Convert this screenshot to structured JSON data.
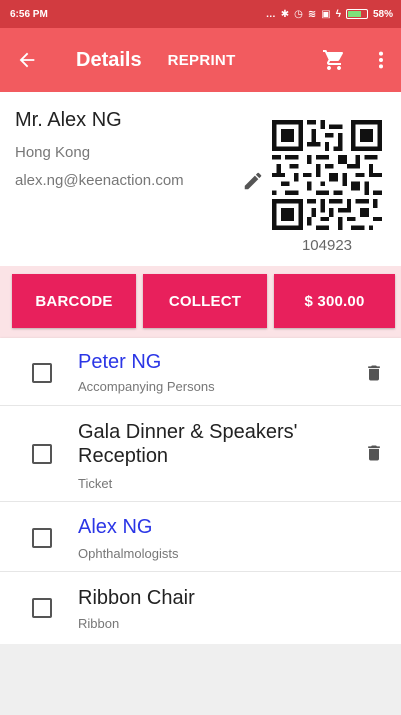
{
  "statusbar": {
    "time": "6:56 PM",
    "battery": "58%"
  },
  "appbar": {
    "title": "Details",
    "reprint_label": "REPRINT"
  },
  "profile": {
    "name": "Mr. Alex NG",
    "city": "Hong Kong",
    "email": "alex.ng@keenaction.com",
    "qr_number": "104923"
  },
  "actions": {
    "barcode_label": "BARCODE",
    "collect_label": "COLLECT",
    "amount_label": "$ 300.00"
  },
  "items": [
    {
      "title": "Peter NG",
      "subtitle": "Accompanying Persons",
      "is_link": true,
      "deletable": true
    },
    {
      "title": "Gala Dinner & Speakers' Reception",
      "subtitle": "Ticket",
      "is_link": false,
      "deletable": true
    },
    {
      "title": "Alex NG",
      "subtitle": "Ophthalmologists",
      "is_link": true,
      "deletable": false
    },
    {
      "title": "Ribbon Chair",
      "subtitle": "Ribbon",
      "is_link": false,
      "deletable": false
    }
  ],
  "colors": {
    "status_bar": "#d23b40",
    "app_bar": "#f25b5f",
    "accent_button": "#e8205c",
    "link": "#2b36e6",
    "action_bg": "#fbe3e6"
  },
  "icons": {
    "back": "arrow-left-icon",
    "cart": "cart-icon",
    "more": "more-vert-icon",
    "edit": "pencil-icon",
    "delete": "trash-icon"
  }
}
